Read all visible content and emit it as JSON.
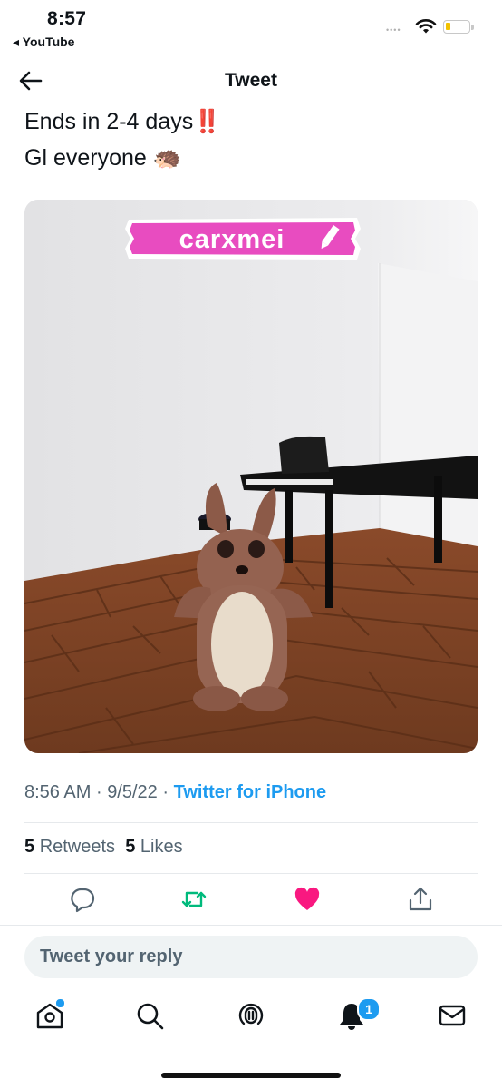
{
  "status_bar": {
    "time": "8:57",
    "back_app": "◂ YouTube",
    "signal": "••••",
    "wifi_icon": "wifi-icon",
    "battery_icon": "battery-icon",
    "battery_color": "#f2c200"
  },
  "header": {
    "title": "Tweet",
    "back_icon": "back-arrow-icon"
  },
  "tweet": {
    "line1_text": "Ends in 2-4 days",
    "line1_emoji": "‼️",
    "line2_text": "Gl everyone",
    "line2_emoji": "🦔",
    "media": {
      "name_tag": "carxmei",
      "name_tag_color": "#e84cc0"
    },
    "time": "8:56 AM",
    "separator": "·",
    "date": "9/5/22",
    "source": "Twitter for iPhone",
    "retweets_count": "5",
    "retweets_label": "Retweets",
    "likes_count": "5",
    "likes_label": "Likes"
  },
  "actions": {
    "reply_icon": "reply-icon",
    "retweet_icon": "retweet-icon",
    "like_icon": "heart-icon",
    "share_icon": "share-icon",
    "retweet_color": "#00ba7c",
    "like_color": "#f91880"
  },
  "reply_box": {
    "placeholder": "Tweet your reply"
  },
  "tab_bar": {
    "items": [
      "home-icon",
      "search-icon",
      "spaces-icon",
      "notifications-icon",
      "messages-icon"
    ],
    "notifications_badge": "1",
    "accent": "#1d9bf0"
  }
}
